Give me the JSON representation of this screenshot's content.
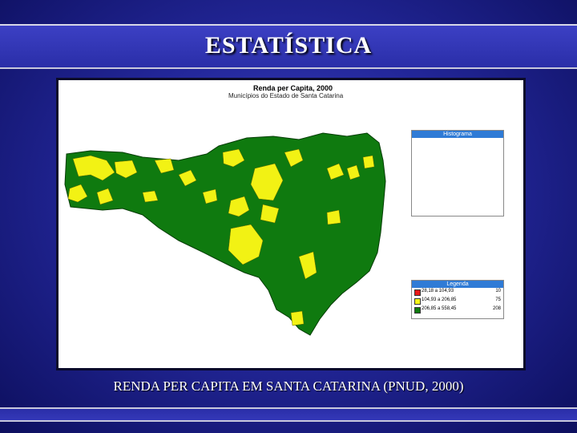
{
  "slide": {
    "title": "ESTATÍSTICA",
    "caption": "RENDA PER CAPITA EM SANTA CATARINA (PNUD, 2000)"
  },
  "map": {
    "title": "Renda per Capita, 2000",
    "subtitle": "Municípios do Estado de Santa Catarina",
    "histogram_title": "Histograma",
    "legend_title": "Legenda",
    "legend": [
      {
        "range": "28,18 a 104,93",
        "count": "10",
        "color": "#e81818"
      },
      {
        "range": "104,93 a 206,85",
        "count": "75",
        "color": "#f5f518"
      },
      {
        "range": "206,85 a 558,45",
        "count": "208",
        "color": "#0f7a0f"
      }
    ]
  }
}
